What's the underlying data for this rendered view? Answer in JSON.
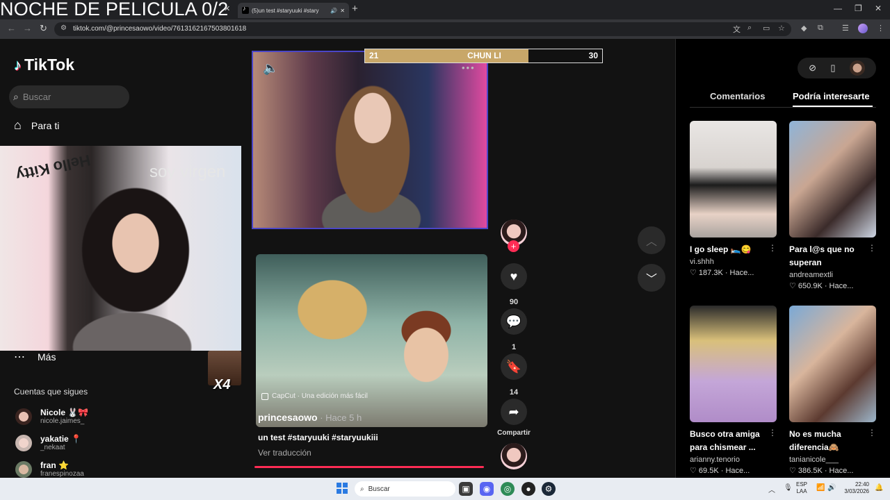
{
  "stream_overlay": {
    "title": "NOCHE DE PELICULA 0/2",
    "webcam_caption": "soy virgen",
    "hello_kitty": "Hello Kitty",
    "emote_multiplier": "X4"
  },
  "browser": {
    "active_tab_title": "(5)un test #staryuuki #stary",
    "url": "tiktok.com/@princesaowo/video/7613162167503801618"
  },
  "healthbar": {
    "left_value": "21",
    "name": "CHUN LI",
    "right_value": "30",
    "fill_fraction": 0.69
  },
  "sidebar": {
    "logo": "TikTok",
    "search_placeholder": "Buscar",
    "nav_for_you": "Para ti",
    "nav_more": "Más",
    "following_title": "Cuentas que sigues",
    "accounts": [
      {
        "name": "Nicole 🐰🎀",
        "handle": "nicole.jaimes_"
      },
      {
        "name": "yakatie 📍",
        "handle": "_nekaat"
      },
      {
        "name": "fran ⭐",
        "handle": "franespinozaa"
      }
    ]
  },
  "video": {
    "capcut_label": "CapCut · Una edición más fácil",
    "author": "princesaowo",
    "time_ago": " · Hace 5 h",
    "caption": "un test #staryuuki #staryuukiii",
    "translate": "Ver traducción",
    "likes": "90",
    "comments": "1",
    "saves": "14",
    "share_label": "Compartir"
  },
  "right_panel": {
    "tab_comments": "Comentarios",
    "tab_recommended": "Podría interesarte",
    "cards": [
      {
        "title": "I go sleep 🛌😋",
        "user": "vi.shhh",
        "stats": "♡ 187.3K · Hace..."
      },
      {
        "title": "Para l@s que no superan",
        "user": "andreamextli",
        "stats": "♡ 650.9K · Hace..."
      },
      {
        "title": "Busco otra amiga para chismear ...",
        "user": "arianny.tenorio",
        "stats": "♡ 69.5K · Hace..."
      },
      {
        "title": "No es mucha diferencia🙈",
        "user": "tanianicole___",
        "stats": "♡ 386.5K · Hace..."
      }
    ]
  },
  "taskbar": {
    "search_placeholder": "Buscar",
    "lang": "ESP",
    "lang2": "LAA",
    "time": "22:40",
    "date": "3/03/2026"
  },
  "colors": {
    "accent": "#fe2c55",
    "healthbar": "#c8a769",
    "cam_border": "#4b46c8"
  }
}
